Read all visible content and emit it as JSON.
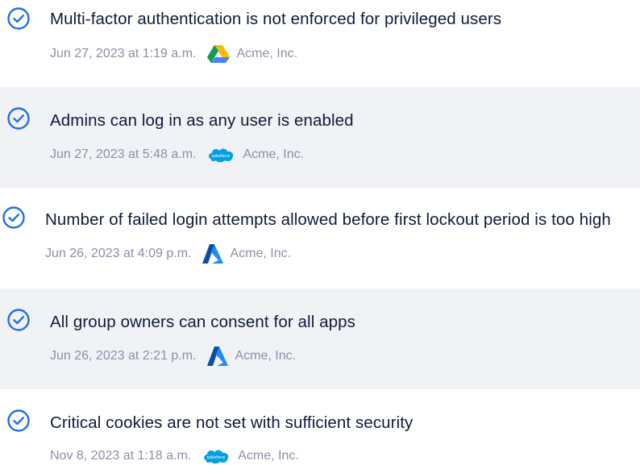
{
  "colors": {
    "accent": "#1f6feb",
    "title_text": "#101a3a",
    "meta_text": "#8a90a8",
    "alt_row_bg": "#f1f2f5"
  },
  "findings": [
    {
      "title": "Multi-factor authentication is not enforced for privileged users",
      "date": "Jun 27, 2023 at 1:19 a.m.",
      "source_icon": "google-drive-icon",
      "org": "Acme, Inc.",
      "status_icon": "check-circle-icon"
    },
    {
      "title": "Admins can log in as any user is enabled",
      "date": "Jun 27, 2023 at 5:48 a.m.",
      "source_icon": "salesforce-icon",
      "org": "Acme, Inc.",
      "status_icon": "check-circle-icon",
      "logo_text": "salesforce"
    },
    {
      "title": "Number of failed login attempts allowed before first lockout period is too high",
      "date": "Jun 26, 2023 at 4:09 p.m.",
      "source_icon": "azure-icon",
      "org": "Acme, Inc.",
      "status_icon": "check-circle-icon"
    },
    {
      "title": "All group owners can consent for all apps",
      "date": "Jun 26, 2023 at 2:21 p.m.",
      "source_icon": "azure-icon",
      "org": "Acme, Inc.",
      "status_icon": "check-circle-icon"
    },
    {
      "title": "Critical cookies are not set with sufficient security",
      "date": "Nov 8, 2023 at 1:18 a.m.",
      "source_icon": "salesforce-icon",
      "org": "Acme, Inc.",
      "status_icon": "check-circle-icon",
      "logo_text": "salesforce"
    }
  ]
}
